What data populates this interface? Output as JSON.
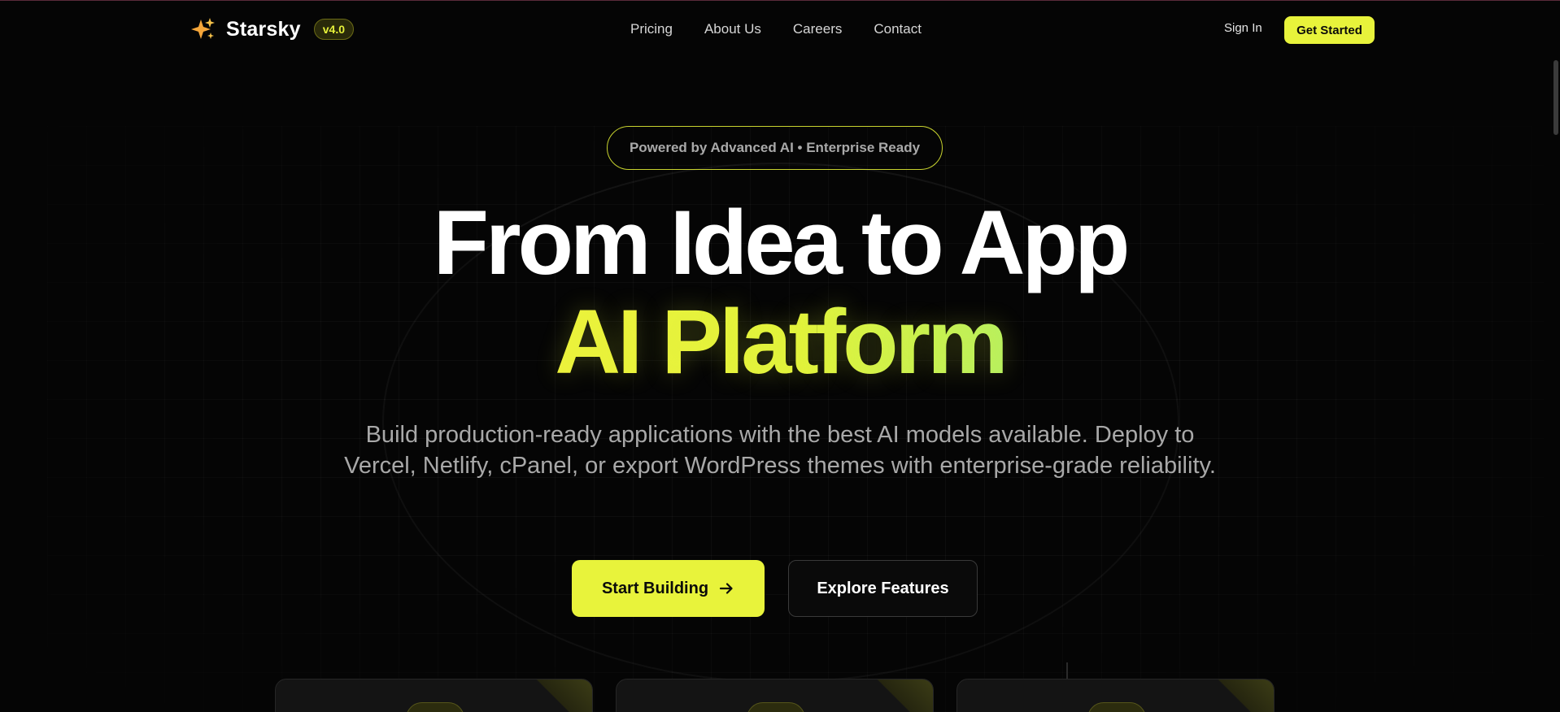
{
  "nav": {
    "brand_name": "Starsky",
    "version": "v4.0",
    "links": [
      "Pricing",
      "About Us",
      "Careers",
      "Contact"
    ],
    "sign_in": "Sign In",
    "get_started": "Get Started"
  },
  "hero": {
    "badge": "Powered by Advanced AI • Enterprise Ready",
    "headline": "From Idea to App",
    "headline_accent": "AI Platform",
    "subtitle": "Build production-ready applications with the best AI models available. Deploy to Vercel, Netlify, cPanel, or export WordPress themes with enterprise-grade reliability.",
    "primary_cta": "Start Building",
    "secondary_cta": "Explore Features"
  },
  "icons": {
    "brand": "sparkles-icon",
    "primary_cta": "arrow-right-icon"
  },
  "colors": {
    "background": "#050505",
    "accent": "#e8f33b",
    "accent_end": "#b6f061",
    "muted_text": "#a8a8a8"
  }
}
